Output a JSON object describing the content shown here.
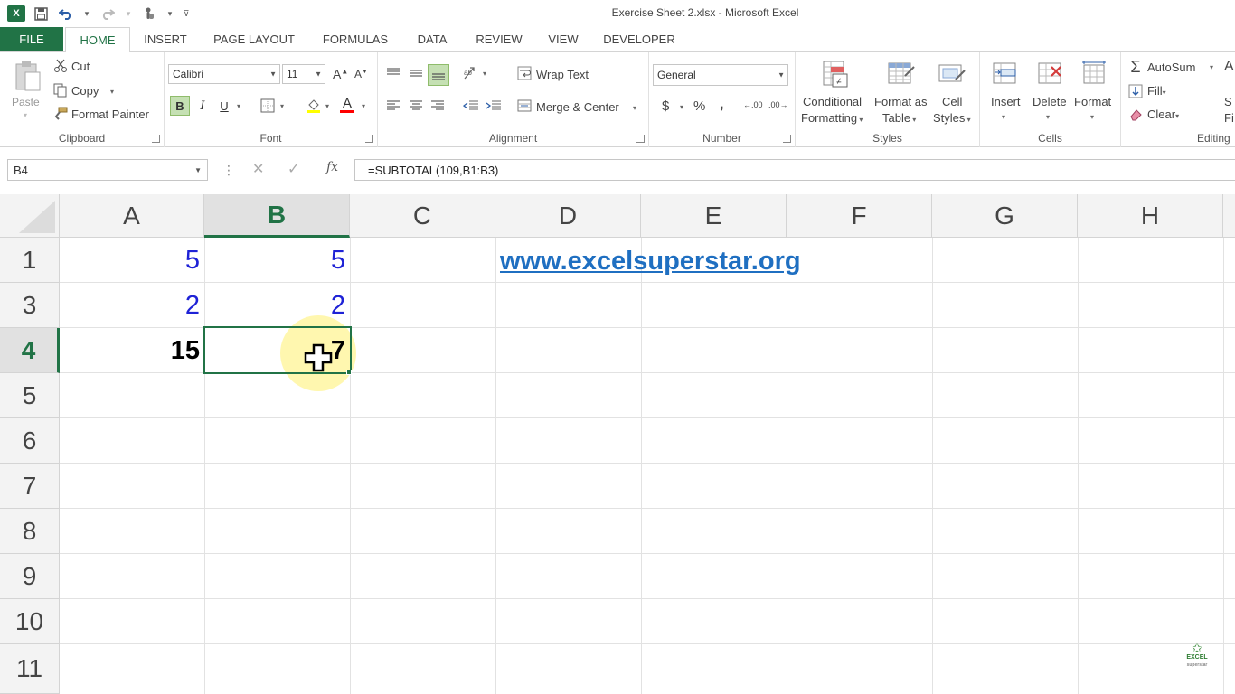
{
  "window": {
    "title": "Exercise Sheet 2.xlsx - Microsoft Excel"
  },
  "qat": {
    "logo": "X"
  },
  "tabs": [
    "FILE",
    "HOME",
    "INSERT",
    "PAGE LAYOUT",
    "FORMULAS",
    "DATA",
    "REVIEW",
    "VIEW",
    "DEVELOPER"
  ],
  "ribbon": {
    "clipboard": {
      "label": "Clipboard",
      "paste": "Paste",
      "cut": "Cut",
      "copy": "Copy",
      "format_painter": "Format Painter"
    },
    "font": {
      "label": "Font",
      "name": "Calibri",
      "size": "11",
      "bold": "B",
      "italic": "I",
      "underline": "U",
      "grow": "A",
      "shrink": "A",
      "color_a": "A"
    },
    "alignment": {
      "label": "Alignment",
      "wrap": "Wrap Text",
      "merge": "Merge & Center"
    },
    "number": {
      "label": "Number",
      "format": "General",
      "currency": "$",
      "percent": "%",
      "comma": ",",
      "inc_dec": ".00",
      "dec_dec": ".00"
    },
    "styles": {
      "label": "Styles",
      "conditional_1": "Conditional",
      "conditional_2": "Formatting",
      "format_as_1": "Format as",
      "format_as_2": "Table",
      "cell_styles_1": "Cell",
      "cell_styles_2": "Styles"
    },
    "cells": {
      "label": "Cells",
      "insert": "Insert",
      "delete": "Delete",
      "format": "Format"
    },
    "editing": {
      "label": "Editing",
      "autosum": "AutoSum",
      "fill": "Fill",
      "clear": "Clear",
      "sort_1": "S",
      "sort_2": "Fi"
    }
  },
  "formula_bar": {
    "name_box": "B4",
    "sep": "⋮",
    "cancel": "✕",
    "enter": "✓",
    "fx": "fx",
    "formula": "=SUBTOTAL(109,B1:B3)"
  },
  "grid": {
    "columns": [
      "A",
      "B",
      "C",
      "D",
      "E",
      "F",
      "G",
      "H"
    ],
    "rows": [
      "1",
      "3",
      "4",
      "5",
      "6",
      "7",
      "8",
      "9",
      "10",
      "11"
    ],
    "selected_column": "B",
    "selected_row": "4",
    "cells": {
      "a1": "5",
      "b1": "5",
      "a3": "2",
      "b3": "2",
      "a4": "15",
      "b4": "7",
      "d1": "www.excelsuperstar.org"
    }
  },
  "watermark": {
    "line1": "EXCEL",
    "line2": "superstar"
  },
  "colors": {
    "excel_green": "#217346",
    "cell_blue": "#1e22d6",
    "link_blue": "#1f6fc1"
  }
}
